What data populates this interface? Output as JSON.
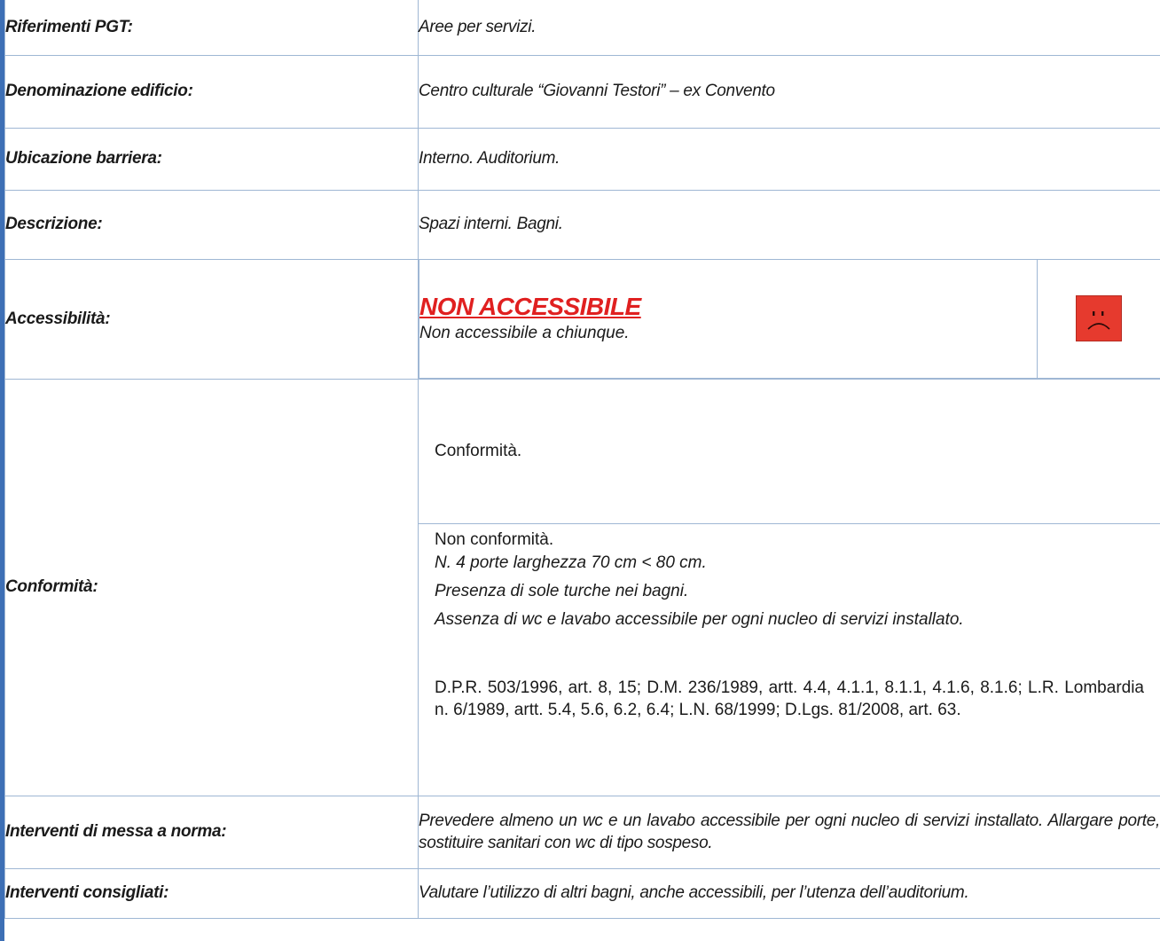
{
  "rows": {
    "pgt": {
      "label": "Riferimenti PGT:",
      "value": "Aree per servizi."
    },
    "denominazione": {
      "label": "Denominazione edificio:",
      "value": "Centro culturale “Giovanni Testori” – ex Convento"
    },
    "ubicazione": {
      "label": "Ubicazione barriera:",
      "value": "Interno. Auditorium."
    },
    "descrizione": {
      "label": "Descrizione:",
      "value": "Spazi interni. Bagni."
    },
    "accessibilita": {
      "label": "Accessibilità:",
      "status": "NON ACCESSIBILE",
      "note": "Non accessibile a chiunque.",
      "icon": "sad-face-icon",
      "icon_color": "#e63a2e",
      "status_color": "#e02020"
    },
    "conformita": {
      "label": "Conformità:",
      "conformita_heading": "Conformità.",
      "non_conformita_heading": "Non conformità.",
      "items": [
        "N. 4 porte larghezza 70 cm < 80 cm.",
        "Presenza di sole turche nei bagni.",
        "Assenza di wc e lavabo accessibile per ogni nucleo di servizi installato."
      ],
      "norme": "D.P.R. 503/1996, art. 8, 15; D.M. 236/1989, artt. 4.4, 4.1.1, 8.1.1, 4.1.6, 8.1.6; L.R. Lombardia n. 6/1989, artt. 5.4, 5.6, 6.2, 6.4; L.N. 68/1999; D.Lgs. 81/2008, art. 63."
    },
    "interventi_norma": {
      "label": "Interventi di messa a norma:",
      "value": "Prevedere almeno un wc e un lavabo accessibile per ogni nucleo di servizi installato. Allargare porte, sostituire sanitari con wc di tipo sospeso."
    },
    "interventi_consigliati": {
      "label": "Interventi consigliati:",
      "value": "Valutare l’utilizzo di altri bagni, anche accessibili, per l’utenza dell’auditorium."
    }
  }
}
